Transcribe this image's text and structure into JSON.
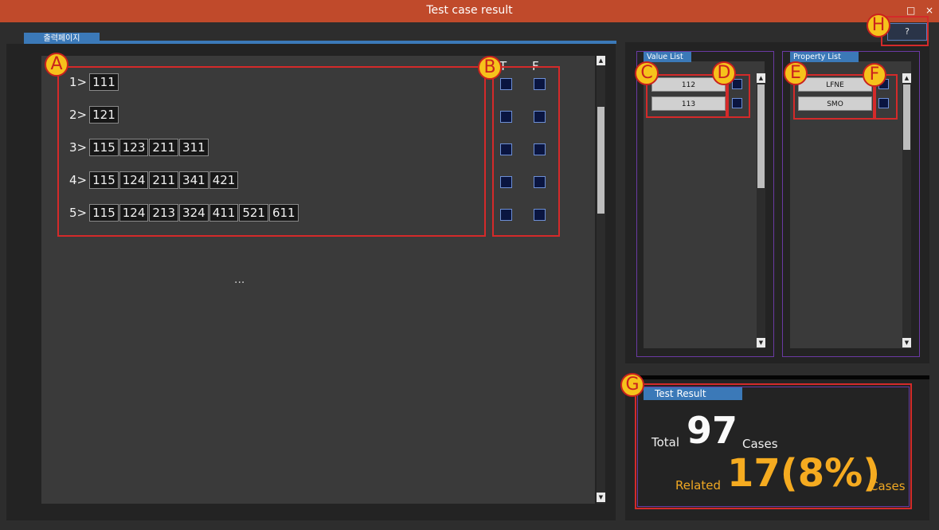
{
  "window": {
    "title": "Test case result",
    "restore_glyph": "□",
    "close_glyph": "×"
  },
  "left": {
    "tab_label": "출력페이지",
    "header_true": "T",
    "header_false": "F",
    "rows": [
      {
        "num": "1>",
        "cells": [
          "111"
        ]
      },
      {
        "num": "2>",
        "cells": [
          "121"
        ]
      },
      {
        "num": "3>",
        "cells": [
          "115",
          "123",
          "211",
          "311"
        ]
      },
      {
        "num": "4>",
        "cells": [
          "115",
          "124",
          "211",
          "341",
          "421"
        ]
      },
      {
        "num": "5>",
        "cells": [
          "115",
          "124",
          "213",
          "324",
          "411",
          "521",
          "611"
        ]
      }
    ],
    "ellipsis": "..."
  },
  "value_list": {
    "title": "Value List",
    "items": [
      "112",
      "113"
    ]
  },
  "property_list": {
    "title": "Property List",
    "items": [
      "LFNE",
      "SMO"
    ]
  },
  "result": {
    "tab_label": "Test Result",
    "total_label": "Total",
    "total_value": "97",
    "total_suffix": "Cases",
    "related_label": "Related",
    "related_value": "17(8%)",
    "related_suffix": "Cases"
  },
  "help_button": "?",
  "annotations": [
    "A",
    "B",
    "C",
    "D",
    "E",
    "F",
    "G",
    "H"
  ],
  "colors": {
    "titlebar": "#c04a2b",
    "accent": "#3b79b8",
    "highlight": "#f5ab20",
    "annotation_box": "#d42a2a",
    "badge": "#f6c21b"
  }
}
